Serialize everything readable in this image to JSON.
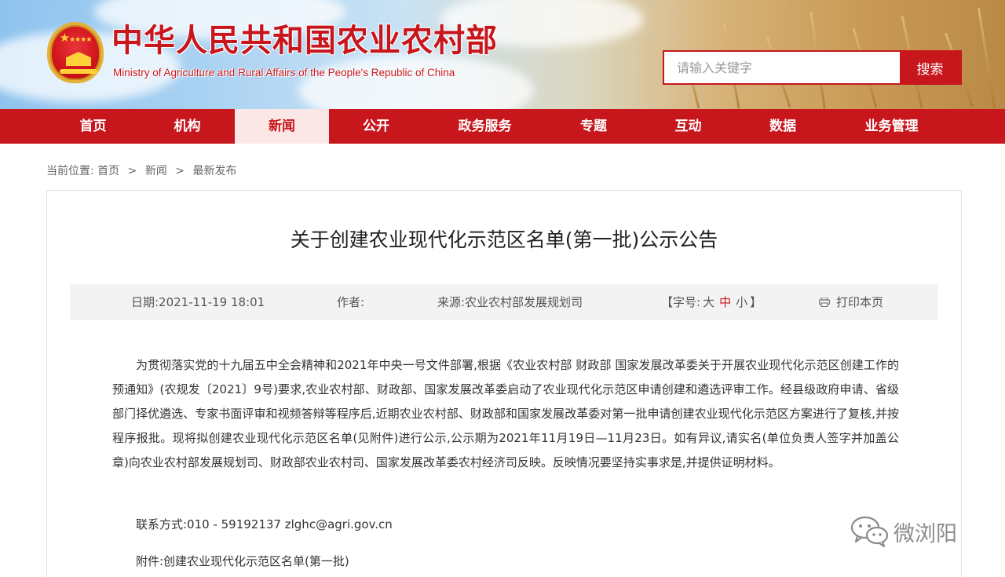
{
  "header": {
    "site_title": "中华人民共和国农业农村部",
    "site_subtitle": "Ministry of Agriculture and Rural Affairs of the People's Republic of China",
    "emblem_icon": "national-emblem",
    "search": {
      "placeholder": "请输入关键字",
      "button_label": "搜索"
    }
  },
  "nav": {
    "items": [
      {
        "label": "首页"
      },
      {
        "label": "机构"
      },
      {
        "label": "新闻",
        "active": true
      },
      {
        "label": "公开"
      },
      {
        "label": "政务服务"
      },
      {
        "label": "专题"
      },
      {
        "label": "互动"
      },
      {
        "label": "数据"
      },
      {
        "label": "业务管理"
      }
    ]
  },
  "breadcrumb": {
    "prefix": "当前位置:",
    "items": [
      "首页",
      "新闻",
      "最新发布"
    ],
    "separator": ">"
  },
  "article": {
    "title": "关于创建农业现代化示范区名单(第一批)公示公告",
    "meta": {
      "date": "日期:2021-11-19 18:01",
      "author": "作者:",
      "source": "来源:农业农村部发展规划司",
      "font_size_open": "【字号:",
      "font_size_large": "大",
      "font_size_medium": "中",
      "font_size_small": "小",
      "font_size_close": "】",
      "print_label": "打印本页",
      "print_icon": "printer-icon"
    },
    "body": "为贯彻落实党的十九届五中全会精神和2021年中央一号文件部署,根据《农业农村部 财政部 国家发展改革委关于开展农业现代化示范区创建工作的预通知》(农规发〔2021〕9号)要求,农业农村部、财政部、国家发展改革委启动了农业现代化示范区申请创建和遴选评审工作。经县级政府申请、省级部门择优遴选、专家书面评审和视频答辩等程序后,近期农业农村部、财政部和国家发展改革委对第一批申请创建农业现代化示范区方案进行了复核,并按程序报批。现将拟创建农业现代化示范区名单(见附件)进行公示,公示期为2021年11月19日—11月23日。如有异议,请实名(单位负责人签字并加盖公章)向农业农村部发展规划司、财政部农业农村司、国家发展改革委农村经济司反映。反映情况要坚持实事求是,并提供证明材料。",
    "contact": "联系方式:010 - 59192137 zlghc@agri.gov.cn",
    "attachment": "附件:创建农业现代化示范区名单(第一批)"
  },
  "watermark": {
    "icon": "wechat-icon",
    "text": "微浏阳"
  },
  "colors": {
    "brand_red": "#c8161d",
    "nav_active_bg": "#fbe8e6",
    "meta_bg": "#f3f3f3"
  }
}
